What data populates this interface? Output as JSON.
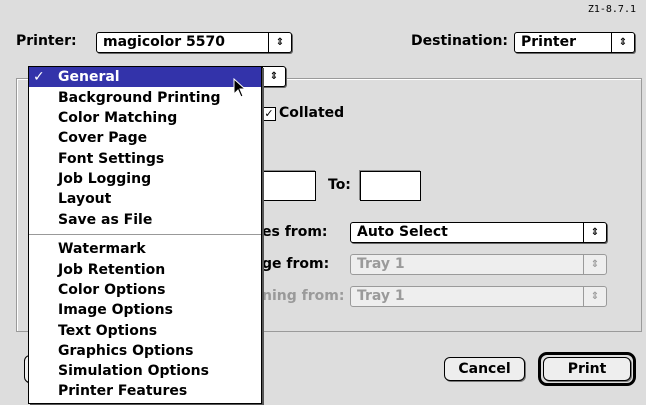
{
  "version": "Z1-8.7.1",
  "printer": {
    "label": "Printer:",
    "value": "magicolor 5570"
  },
  "destination": {
    "label": "Destination:",
    "value": "Printer"
  },
  "copies": {
    "collated_label": "Collated",
    "collated_checked": true
  },
  "pages": {
    "to_label": "To:",
    "from_value": "",
    "to_value": ""
  },
  "paper_source": [
    {
      "label": "es from:",
      "value": "Auto Select",
      "enabled": true
    },
    {
      "label": "ge from:",
      "value": "Tray 1",
      "enabled": false
    },
    {
      "label": "ning from:",
      "value": "Tray 1",
      "enabled": false
    }
  ],
  "menu": {
    "check_glyph": "✓",
    "items_group1": [
      "General",
      "Background Printing",
      "Color Matching",
      "Cover Page",
      "Font Settings",
      "Job Logging",
      "Layout",
      "Save as File"
    ],
    "items_group2": [
      "Watermark",
      "Job Retention",
      "Color Options",
      "Image Options",
      "Text Options",
      "Graphics Options",
      "Simulation Options",
      "Printer Features"
    ],
    "selected": "General"
  },
  "buttons": {
    "cancel": "Cancel",
    "print": "Print"
  },
  "colors": {
    "background": "#dddddd",
    "menu_highlight": "#3333aa"
  },
  "icons": {
    "popup_arrow": "up-down-arrows-icon",
    "pointer": "mouse-pointer-icon"
  }
}
